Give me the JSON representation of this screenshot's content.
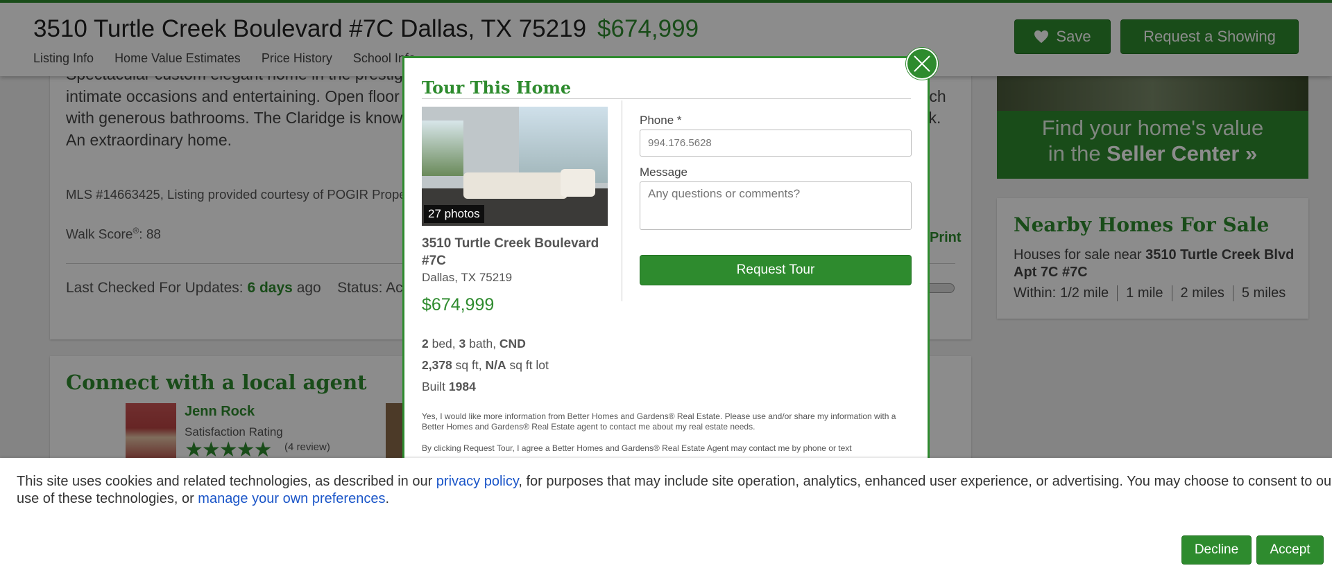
{
  "header": {
    "address": "3510 Turtle Creek Boulevard #7C Dallas, TX 75219",
    "price": "$674,999",
    "nav": [
      "Listing Info",
      "Home Value Estimates",
      "Price History",
      "School Info"
    ],
    "save_label": "Save",
    "showing_label": "Request a Showing"
  },
  "listing": {
    "description": "Spectacular custom elegant home in the prestigious Claridge with sweeping views of Turtle Creek. Designed for living, intimate occasions and entertaining. Open floor plan with spaces extra large dining room, study, balcony, two bedrooms each with generous bathrooms. The Claridge is known for its amenities including concierge, pool, racquet ball court and dog park. An extraordinary home.",
    "mls": "MLS #14663425, Listing provided courtesy of POGIR Properties",
    "walk_score_label": "Walk Score",
    "walk_score_value": ": 88",
    "print_label": "Print",
    "checked_label": "Last Checked For Updates: ",
    "checked_value": "6 days",
    "checked_suffix": " ago",
    "status_label": "Status: Active"
  },
  "agent": {
    "section_title": "Connect with a local agent",
    "name": "Jenn Rock",
    "rating_label": "Satisfaction Rating",
    "stars": "★★★★★",
    "reviews": "(4 review)"
  },
  "sidebar": {
    "seller_line1": "Find your home's value",
    "seller_line2_prefix": "in the ",
    "seller_line2_bold": "Seller Center »",
    "nearby_title": "Nearby Homes For Sale",
    "nearby_prefix": "Houses for sale near ",
    "nearby_address": "3510 Turtle Creek Blvd Apt 7C #7C",
    "within_label": "Within:",
    "distances": [
      "1/2 mile",
      "1 mile",
      "2 miles",
      "5 miles"
    ]
  },
  "modal": {
    "title": "Tour This Home",
    "photo_count": "27 photos",
    "address": "3510 Turtle Creek Boulevard #7C",
    "city": "Dallas, TX 75219",
    "price": "$674,999",
    "beds": "2",
    "beds_label": " bed, ",
    "baths": "3",
    "baths_label": " bath, ",
    "type": "CND",
    "sqft": "2,378",
    "sqft_label": " sq ft, ",
    "lot": "N/A",
    "lot_label": " sq ft lot",
    "built_label": "Built ",
    "built": "1984",
    "phone_label": "Phone *",
    "phone_value": "994.176.5628",
    "message_label": "Message",
    "message_placeholder": "Any questions or comments?",
    "submit_label": "Request Tour",
    "consent_1": "Yes, I would like more information from Better Homes and Gardens® Real Estate. Please use and/or share my information with a Better Homes and Gardens® Real Estate agent to contact me about my real estate needs.",
    "consent_2": "By clicking Request Tour, I agree a Better Homes and Gardens® Real Estate Agent may contact me by phone or text"
  },
  "cookie": {
    "text_before": "This site uses cookies and related technologies, as described in our ",
    "privacy_link": "privacy policy",
    "text_middle": ", for purposes that may include site operation, analytics, enhanced user experience, or advertising. You may choose to consent to our use of these technologies, or ",
    "prefs_link": "manage your own preferences",
    "text_after": ".",
    "decline_label": "Decline",
    "accept_label": "Accept"
  },
  "colors": {
    "brand_green": "#2e8b2e",
    "link_blue": "#1a55c8"
  },
  "icons": [
    "heart-icon",
    "close-icon",
    "star-icon"
  ]
}
